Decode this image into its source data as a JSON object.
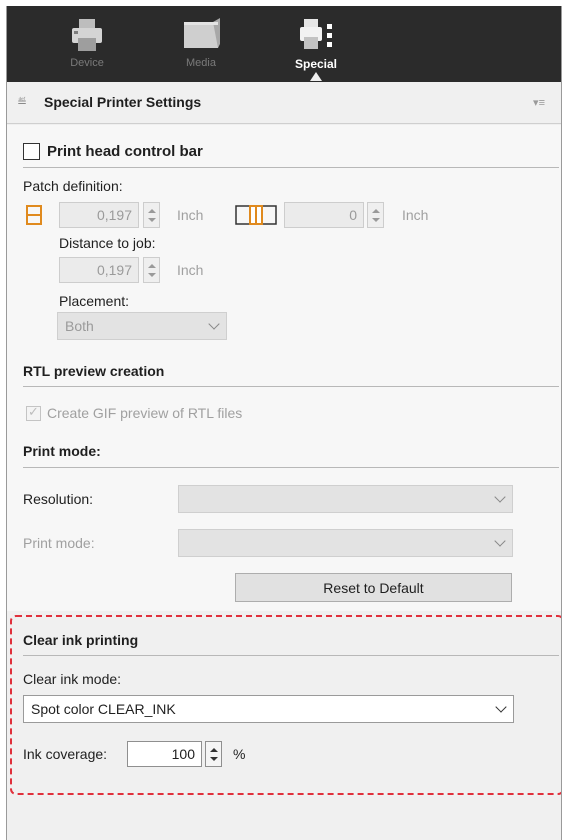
{
  "tabs": [
    {
      "label": "Device",
      "icon": "printer-icon",
      "active": false
    },
    {
      "label": "Media",
      "icon": "media-icon",
      "active": false
    },
    {
      "label": "Special",
      "icon": "special-printer-icon",
      "active": true
    }
  ],
  "panel": {
    "title": "Special Printer Settings"
  },
  "print_head": {
    "checkbox_label": "Print head control bar",
    "checked": false,
    "patch_definition_label": "Patch definition:",
    "patch_height": {
      "value": "0,197",
      "unit": "Inch",
      "icon": "patch-height-icon"
    },
    "patch_width": {
      "value": "0",
      "unit": "Inch",
      "icon": "patch-width-icon"
    },
    "distance_label": "Distance to job:",
    "distance": {
      "value": "0,197",
      "unit": "Inch"
    },
    "placement_label": "Placement:",
    "placement_value": "Both"
  },
  "rtl": {
    "heading": "RTL preview creation",
    "checkbox_label": "Create GIF preview of RTL files",
    "checked": true
  },
  "print_mode": {
    "heading": "Print mode:",
    "resolution_label": "Resolution:",
    "resolution_value": "",
    "mode_label": "Print mode:",
    "mode_value": "",
    "reset_label": "Reset to Default"
  },
  "clear_ink": {
    "heading": "Clear ink printing",
    "mode_label": "Clear ink mode:",
    "mode_value": "Spot color CLEAR_INK",
    "coverage_label": "Ink coverage:",
    "coverage_value": "100",
    "coverage_unit": "%"
  },
  "colors": {
    "topbar": "#2b2b2b",
    "highlight": "#e0303c"
  }
}
